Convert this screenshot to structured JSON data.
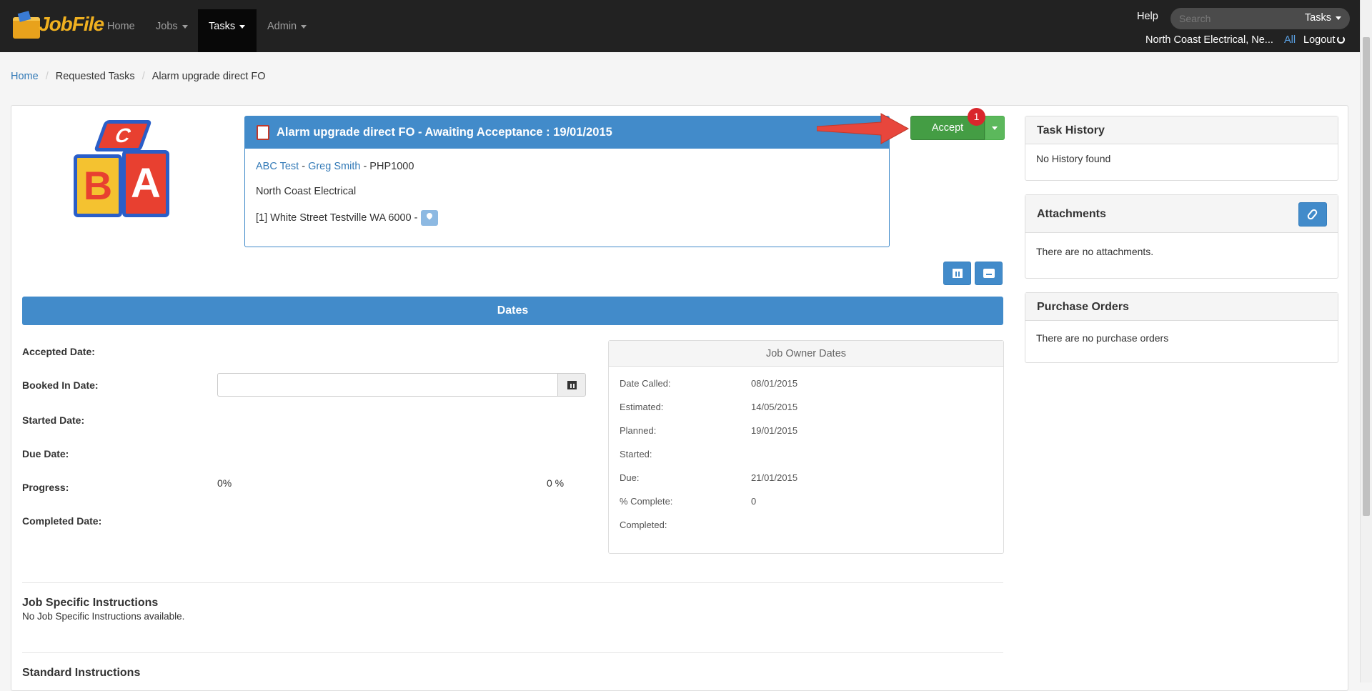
{
  "nav": {
    "brand": "JobFile",
    "items": [
      {
        "label": "Home",
        "dropdown": false
      },
      {
        "label": "Jobs",
        "dropdown": true
      },
      {
        "label": "Tasks",
        "dropdown": true,
        "active": true
      },
      {
        "label": "Admin",
        "dropdown": true
      }
    ],
    "help": "Help",
    "search_placeholder": "Search",
    "search_scope": "Tasks",
    "company": "North Coast Electrical, Ne...",
    "all": "All",
    "logout": "Logout"
  },
  "breadcrumb": [
    "Home",
    "Requested Tasks",
    "Alarm upgrade direct FO"
  ],
  "task": {
    "title": "Alarm upgrade direct FO - Awaiting Acceptance : 19/01/2015",
    "client": "ABC Test",
    "contact": "Greg Smith",
    "ref": "- PHP1000",
    "company": "North Coast Electrical",
    "address": "[1] White Street Testville WA 6000 -"
  },
  "actions": {
    "accept_label": "Accept",
    "badge": "1"
  },
  "dates": {
    "title": "Dates",
    "labels": [
      "Accepted Date:",
      "Booked In Date:",
      "Started Date:",
      "Due Date:",
      "Progress:",
      "Completed Date:"
    ],
    "progress_left": "0%",
    "progress_right": "0 %"
  },
  "owner_dates": {
    "title": "Job Owner Dates",
    "rows": [
      {
        "label": "Date Called:",
        "value": "08/01/2015"
      },
      {
        "label": "Estimated:",
        "value": "14/05/2015"
      },
      {
        "label": "Planned:",
        "value": "19/01/2015"
      },
      {
        "label": "Started:",
        "value": ""
      },
      {
        "label": "Due:",
        "value": "21/01/2015"
      },
      {
        "label": "% Complete:",
        "value": "0"
      },
      {
        "label": "Completed:",
        "value": ""
      }
    ]
  },
  "instructions": {
    "job_title": "Job Specific Instructions",
    "job_text": "No Job Specific Instructions available.",
    "standard_title": "Standard Instructions"
  },
  "side": {
    "history_title": "Task History",
    "history_text": "No History found",
    "attachments_title": "Attachments",
    "attachments_text": "There are no attachments.",
    "po_title": "Purchase Orders",
    "po_text": "There are no purchase orders"
  },
  "colors": {
    "navbar": "#222222",
    "primary": "#428bca",
    "success": "#449d44",
    "badge": "#d9262c"
  }
}
